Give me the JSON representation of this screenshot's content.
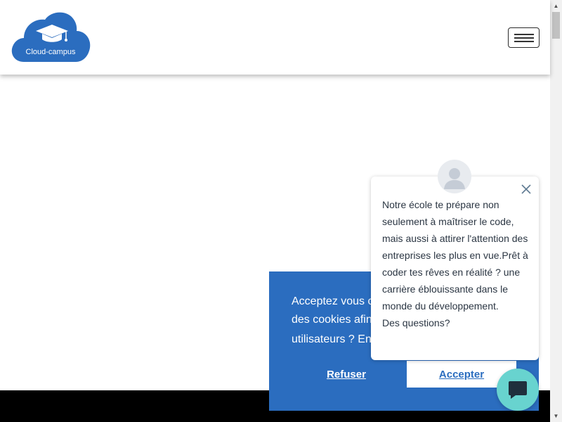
{
  "header": {
    "logo_text": "Cloud-campus",
    "logo_icon": "graduation-cap-cloud-icon",
    "menu_icon": "hamburger-menu-icon"
  },
  "cookie_banner": {
    "text_line1": "Acceptez vous c",
    "text_line2": "des cookies afin",
    "text_line3": "utilisateurs ? En",
    "refuse_label": "Refuser",
    "accept_label": "Accepter",
    "background_color": "#2b6dbf"
  },
  "chat_popup": {
    "message": "Notre école te prépare non seulement à maîtriser le code, mais aussi à attirer l'attention des entreprises les plus en vue.Prêt à coder tes rêves en réalité ? une carrière éblouissante dans le monde du développement.",
    "question": "Des questions?",
    "close_icon": "close-icon",
    "avatar_icon": "user-avatar-icon"
  },
  "chat_launcher": {
    "icon": "chat-bubble-icon",
    "color": "#68d3cf"
  },
  "colors": {
    "brand_blue": "#2b6dbf",
    "footer": "#000000"
  }
}
